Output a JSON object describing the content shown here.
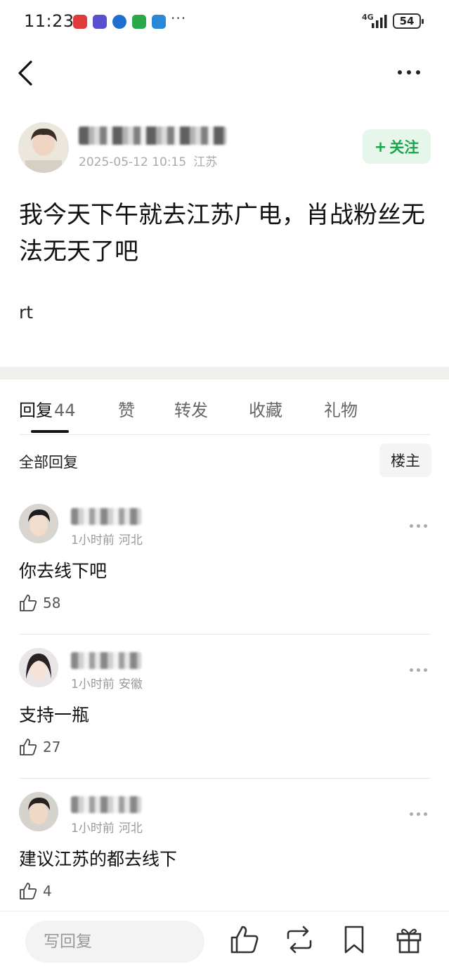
{
  "status_bar": {
    "time": "11:23",
    "network": "4G",
    "battery": "54",
    "more_indicator": "···",
    "app_icon_colors": [
      "#e03a3a",
      "#5a4fcf",
      "#1f6fd1",
      "#2aa84a",
      "#2a88d8"
    ]
  },
  "nav": {
    "back_icon": "chevron-left-icon",
    "more_icon": "more-horizontal-icon"
  },
  "author": {
    "date": "2025-05-12 10:15",
    "location": "江苏",
    "follow_label": "关注",
    "follow_prefix": "+"
  },
  "post": {
    "title": "我今天下午就去江苏广电，肖战粉丝无法无天了吧",
    "body": "rt"
  },
  "tabs": [
    {
      "label": "回复",
      "count": "44",
      "active": true
    },
    {
      "label": "赞"
    },
    {
      "label": "转发"
    },
    {
      "label": "收藏"
    },
    {
      "label": "礼物"
    }
  ],
  "filter": {
    "label": "全部回复",
    "owner_button": "楼主"
  },
  "comments": [
    {
      "time": "1小时前",
      "location": "河北",
      "text": "你去线下吧",
      "likes": "58"
    },
    {
      "time": "1小时前",
      "location": "安徽",
      "text": "支持一瓶",
      "likes": "27"
    },
    {
      "time": "1小时前",
      "location": "河北",
      "text": "建议江苏的都去线下",
      "likes": "4"
    }
  ],
  "bottom_bar": {
    "reply_placeholder": "写回复",
    "icons": [
      "thumbs-up-icon",
      "repost-icon",
      "bookmark-icon",
      "gift-icon"
    ]
  },
  "colors": {
    "accent_green": "#1aa64a",
    "follow_bg": "#e6f6ea",
    "divider": "#f0f0ec"
  }
}
